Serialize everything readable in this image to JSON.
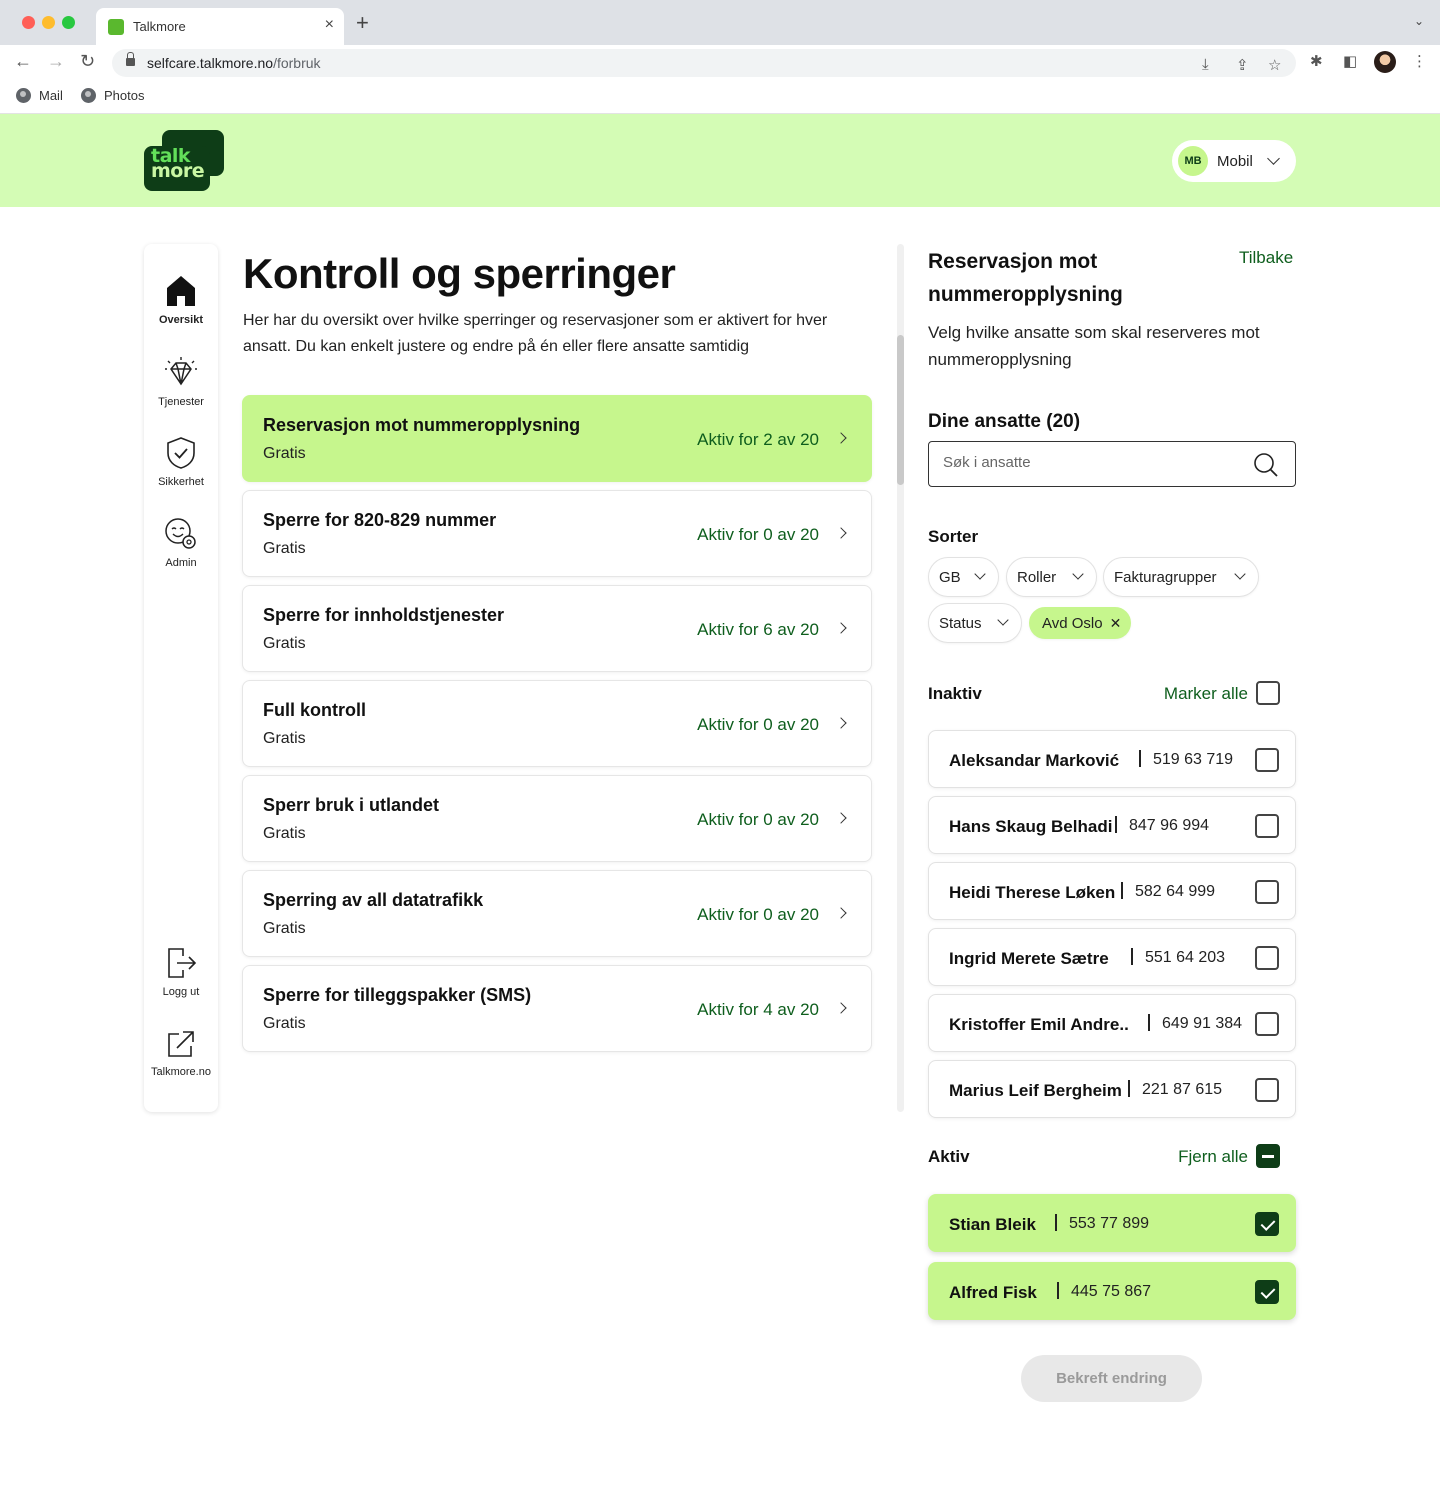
{
  "browser": {
    "tab_title": "Talkmore",
    "url_host": "selfcare.talkmore.no",
    "url_path": "/forbruk",
    "bookmarks": [
      "Mail",
      "Photos"
    ]
  },
  "header": {
    "logo_line1": "talk",
    "logo_line2": "more",
    "account_initials": "MB",
    "account_label": "Mobil"
  },
  "sidebar": {
    "items": [
      {
        "label": "Oversikt",
        "icon": "home-icon",
        "active": true
      },
      {
        "label": "Tjenester",
        "icon": "diamond-icon",
        "active": false
      },
      {
        "label": "Sikkerhet",
        "icon": "shield-icon",
        "active": false
      },
      {
        "label": "Admin",
        "icon": "admin-face-icon",
        "active": false
      }
    ],
    "bottom_items": [
      {
        "label": "Logg ut",
        "icon": "logout-icon"
      },
      {
        "label": "Talkmore.no",
        "icon": "external-link-icon"
      }
    ]
  },
  "main": {
    "title": "Kontroll og sperringer",
    "description": "Her har du oversikt over hvilke sperringer og reservasjoner som er aktivert for hver ansatt. Du kan enkelt justere og endre på én eller flere ansatte samtidig",
    "blocks": [
      {
        "title": "Reservasjon mot nummeropplysning",
        "price": "Gratis",
        "status": "Aktiv for 2 av 20",
        "selected": true
      },
      {
        "title": "Sperre for 820-829 nummer",
        "price": "Gratis",
        "status": "Aktiv for 0 av 20",
        "selected": false
      },
      {
        "title": "Sperre for innholdstjenester",
        "price": "Gratis",
        "status": "Aktiv for 6 av 20",
        "selected": false
      },
      {
        "title": "Full kontroll",
        "price": "Gratis",
        "status": "Aktiv for 0 av 20",
        "selected": false
      },
      {
        "title": "Sperr bruk i utlandet",
        "price": "Gratis",
        "status": "Aktiv for 0 av 20",
        "selected": false
      },
      {
        "title": "Sperring av all datatrafikk",
        "price": "Gratis",
        "status": "Aktiv for 0 av 20",
        "selected": false
      },
      {
        "title": "Sperre for tilleggspakker (SMS)",
        "price": "Gratis",
        "status": "Aktiv for 4 av 20",
        "selected": false
      }
    ]
  },
  "panel": {
    "title": "Reservasjon mot nummeropplysning",
    "back_label": "Tilbake",
    "description": "Velg hvilke ansatte som skal reserveres mot nummeropplysning",
    "employees_heading": "Dine ansatte (20)",
    "search_placeholder": "Søk i ansatte",
    "sort_label": "Sorter",
    "filters": [
      "GB",
      "Roller",
      "Fakturagrupper",
      "Status"
    ],
    "active_filter": "Avd Oslo",
    "inactive_label": "Inaktiv",
    "select_all_label": "Marker alle",
    "inactive_employees": [
      {
        "name": "Aleksandar Marković",
        "phone": "519 63 719"
      },
      {
        "name": "Hans Skaug Belhadi",
        "phone": "847 96 994"
      },
      {
        "name": "Heidi Therese Løken",
        "phone": "582 64 999"
      },
      {
        "name": "Ingrid Merete Sætre",
        "phone": "551 64 203"
      },
      {
        "name": "Kristoffer Emil Andre..",
        "phone": "649 91 384"
      },
      {
        "name": "Marius Leif Bergheim",
        "phone": "221 87 615"
      }
    ],
    "active_label": "Aktiv",
    "remove_all_label": "Fjern alle",
    "active_employees": [
      {
        "name": "Stian Bleik",
        "phone": "553 77 899"
      },
      {
        "name": "Alfred Fisk",
        "phone": "445 75 867"
      }
    ],
    "confirm_label": "Bekreft endring"
  },
  "colors": {
    "brand_dark": "#0e3d17",
    "brand_light": "#c6f68d",
    "header_bg": "#d4fcb5",
    "link_green": "#0e5e1d"
  }
}
